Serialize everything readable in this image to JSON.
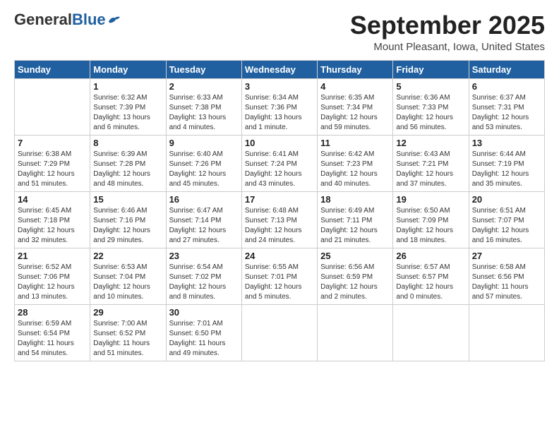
{
  "header": {
    "logo_general": "General",
    "logo_blue": "Blue",
    "month_title": "September 2025",
    "location": "Mount Pleasant, Iowa, United States"
  },
  "days_of_week": [
    "Sunday",
    "Monday",
    "Tuesday",
    "Wednesday",
    "Thursday",
    "Friday",
    "Saturday"
  ],
  "weeks": [
    [
      {
        "day": "",
        "info": ""
      },
      {
        "day": "1",
        "info": "Sunrise: 6:32 AM\nSunset: 7:39 PM\nDaylight: 13 hours\nand 6 minutes."
      },
      {
        "day": "2",
        "info": "Sunrise: 6:33 AM\nSunset: 7:38 PM\nDaylight: 13 hours\nand 4 minutes."
      },
      {
        "day": "3",
        "info": "Sunrise: 6:34 AM\nSunset: 7:36 PM\nDaylight: 13 hours\nand 1 minute."
      },
      {
        "day": "4",
        "info": "Sunrise: 6:35 AM\nSunset: 7:34 PM\nDaylight: 12 hours\nand 59 minutes."
      },
      {
        "day": "5",
        "info": "Sunrise: 6:36 AM\nSunset: 7:33 PM\nDaylight: 12 hours\nand 56 minutes."
      },
      {
        "day": "6",
        "info": "Sunrise: 6:37 AM\nSunset: 7:31 PM\nDaylight: 12 hours\nand 53 minutes."
      }
    ],
    [
      {
        "day": "7",
        "info": "Sunrise: 6:38 AM\nSunset: 7:29 PM\nDaylight: 12 hours\nand 51 minutes."
      },
      {
        "day": "8",
        "info": "Sunrise: 6:39 AM\nSunset: 7:28 PM\nDaylight: 12 hours\nand 48 minutes."
      },
      {
        "day": "9",
        "info": "Sunrise: 6:40 AM\nSunset: 7:26 PM\nDaylight: 12 hours\nand 45 minutes."
      },
      {
        "day": "10",
        "info": "Sunrise: 6:41 AM\nSunset: 7:24 PM\nDaylight: 12 hours\nand 43 minutes."
      },
      {
        "day": "11",
        "info": "Sunrise: 6:42 AM\nSunset: 7:23 PM\nDaylight: 12 hours\nand 40 minutes."
      },
      {
        "day": "12",
        "info": "Sunrise: 6:43 AM\nSunset: 7:21 PM\nDaylight: 12 hours\nand 37 minutes."
      },
      {
        "day": "13",
        "info": "Sunrise: 6:44 AM\nSunset: 7:19 PM\nDaylight: 12 hours\nand 35 minutes."
      }
    ],
    [
      {
        "day": "14",
        "info": "Sunrise: 6:45 AM\nSunset: 7:18 PM\nDaylight: 12 hours\nand 32 minutes."
      },
      {
        "day": "15",
        "info": "Sunrise: 6:46 AM\nSunset: 7:16 PM\nDaylight: 12 hours\nand 29 minutes."
      },
      {
        "day": "16",
        "info": "Sunrise: 6:47 AM\nSunset: 7:14 PM\nDaylight: 12 hours\nand 27 minutes."
      },
      {
        "day": "17",
        "info": "Sunrise: 6:48 AM\nSunset: 7:13 PM\nDaylight: 12 hours\nand 24 minutes."
      },
      {
        "day": "18",
        "info": "Sunrise: 6:49 AM\nSunset: 7:11 PM\nDaylight: 12 hours\nand 21 minutes."
      },
      {
        "day": "19",
        "info": "Sunrise: 6:50 AM\nSunset: 7:09 PM\nDaylight: 12 hours\nand 18 minutes."
      },
      {
        "day": "20",
        "info": "Sunrise: 6:51 AM\nSunset: 7:07 PM\nDaylight: 12 hours\nand 16 minutes."
      }
    ],
    [
      {
        "day": "21",
        "info": "Sunrise: 6:52 AM\nSunset: 7:06 PM\nDaylight: 12 hours\nand 13 minutes."
      },
      {
        "day": "22",
        "info": "Sunrise: 6:53 AM\nSunset: 7:04 PM\nDaylight: 12 hours\nand 10 minutes."
      },
      {
        "day": "23",
        "info": "Sunrise: 6:54 AM\nSunset: 7:02 PM\nDaylight: 12 hours\nand 8 minutes."
      },
      {
        "day": "24",
        "info": "Sunrise: 6:55 AM\nSunset: 7:01 PM\nDaylight: 12 hours\nand 5 minutes."
      },
      {
        "day": "25",
        "info": "Sunrise: 6:56 AM\nSunset: 6:59 PM\nDaylight: 12 hours\nand 2 minutes."
      },
      {
        "day": "26",
        "info": "Sunrise: 6:57 AM\nSunset: 6:57 PM\nDaylight: 12 hours\nand 0 minutes."
      },
      {
        "day": "27",
        "info": "Sunrise: 6:58 AM\nSunset: 6:56 PM\nDaylight: 11 hours\nand 57 minutes."
      }
    ],
    [
      {
        "day": "28",
        "info": "Sunrise: 6:59 AM\nSunset: 6:54 PM\nDaylight: 11 hours\nand 54 minutes."
      },
      {
        "day": "29",
        "info": "Sunrise: 7:00 AM\nSunset: 6:52 PM\nDaylight: 11 hours\nand 51 minutes."
      },
      {
        "day": "30",
        "info": "Sunrise: 7:01 AM\nSunset: 6:50 PM\nDaylight: 11 hours\nand 49 minutes."
      },
      {
        "day": "",
        "info": ""
      },
      {
        "day": "",
        "info": ""
      },
      {
        "day": "",
        "info": ""
      },
      {
        "day": "",
        "info": ""
      }
    ]
  ]
}
